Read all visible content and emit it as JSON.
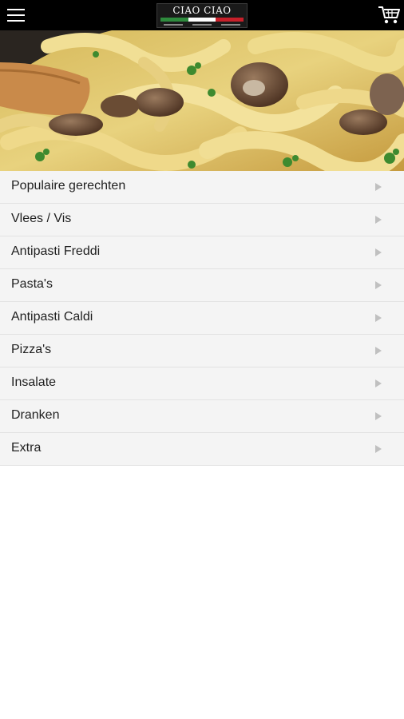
{
  "header": {
    "menu_icon": "hamburger-menu-icon",
    "logo_text": "CIAO CIAO",
    "logo_flag_colors": [
      "#2e8b3d",
      "#ffffff",
      "#c8202a"
    ],
    "cart_icon": "shopping-cart-icon"
  },
  "hero": {
    "image": "pasta-with-mushrooms-photo"
  },
  "menu": {
    "items": [
      {
        "label": "Populaire gerechten"
      },
      {
        "label": "Vlees / Vis"
      },
      {
        "label": "Antipasti Freddi"
      },
      {
        "label": "Pasta's"
      },
      {
        "label": "Antipasti Caldi"
      },
      {
        "label": "Pizza's"
      },
      {
        "label": "Insalate"
      },
      {
        "label": "Dranken"
      },
      {
        "label": "Extra"
      }
    ],
    "arrow_icon": "chevron-right-icon"
  },
  "colors": {
    "topbar": "#000000",
    "row_bg": "#f4f4f4",
    "row_divider": "#e2e2e2",
    "arrow": "#c0c0c0"
  }
}
